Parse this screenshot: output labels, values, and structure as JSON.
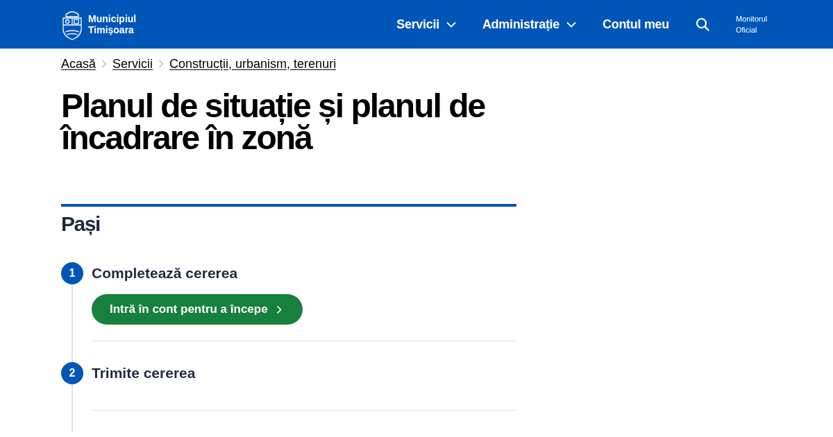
{
  "header": {
    "logo": {
      "line1": "Municipiul",
      "line2": "Timișoara"
    },
    "nav": [
      {
        "label": "Servicii",
        "kind": "dropdown"
      },
      {
        "label": "Administrație",
        "kind": "dropdown"
      },
      {
        "label": "Contul meu",
        "kind": "link"
      }
    ],
    "secondary": {
      "line1": "Monitorul",
      "line2": "Oficial"
    }
  },
  "breadcrumbs": [
    "Acasă",
    "Servicii",
    "Construcții, urbanism, terenuri"
  ],
  "title": "Planul de situație și planul de încadrare în zonă",
  "steps_section": {
    "heading": "Pași",
    "steps": [
      {
        "number": "1",
        "title": "Completează cererea",
        "button": "Intră în cont pentru a începe"
      },
      {
        "number": "2",
        "title": "Trimite cererea"
      }
    ]
  }
}
